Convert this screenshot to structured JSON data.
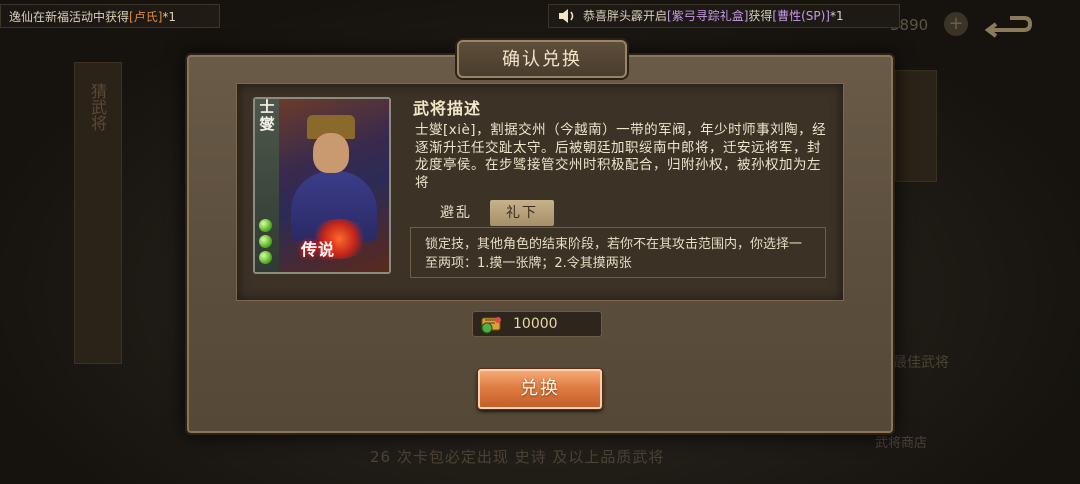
{
  "notices": {
    "left": {
      "prefix": "逸仙在新福活动中获得",
      "item": "[卢氏]",
      "count": "*1"
    },
    "right": {
      "prefix": "恭喜胖头霹开启",
      "item": "[紫弓寻踪礼盒]",
      "mid": "获得",
      "prize": "[曹性(SP)]",
      "count": "*1"
    }
  },
  "background": {
    "left_tab": "猜武将",
    "resource_value": "3890",
    "bottom_hint": "26 次卡包必定出现 史诗 及以上品质武将",
    "right_label": "最佳武将",
    "right_label2": "武将商店"
  },
  "dialog": {
    "title": "确认兑换",
    "card": {
      "name": "士燮",
      "rarity_tag": "传说"
    },
    "desc_title": "武将描述",
    "desc_text": "士燮[xiè]，割据交州（今越南）一带的军阀，年少时师事刘陶，经逐渐升迁任交趾太守。后被朝廷加职绥南中郎将，迁安远将军，封龙度亭侯。在步骘接管交州时积极配合，归附孙权，被孙权加为左将",
    "tabs": [
      {
        "label": "避乱",
        "active": false
      },
      {
        "label": "礼下",
        "active": true
      }
    ],
    "skill_text": "锁定技，其他角色的结束阶段，若你不在其攻击范围内，你选择一至两项：1.摸一张牌；2.令其摸两张",
    "cost_value": "10000",
    "confirm_button": "兑换"
  }
}
